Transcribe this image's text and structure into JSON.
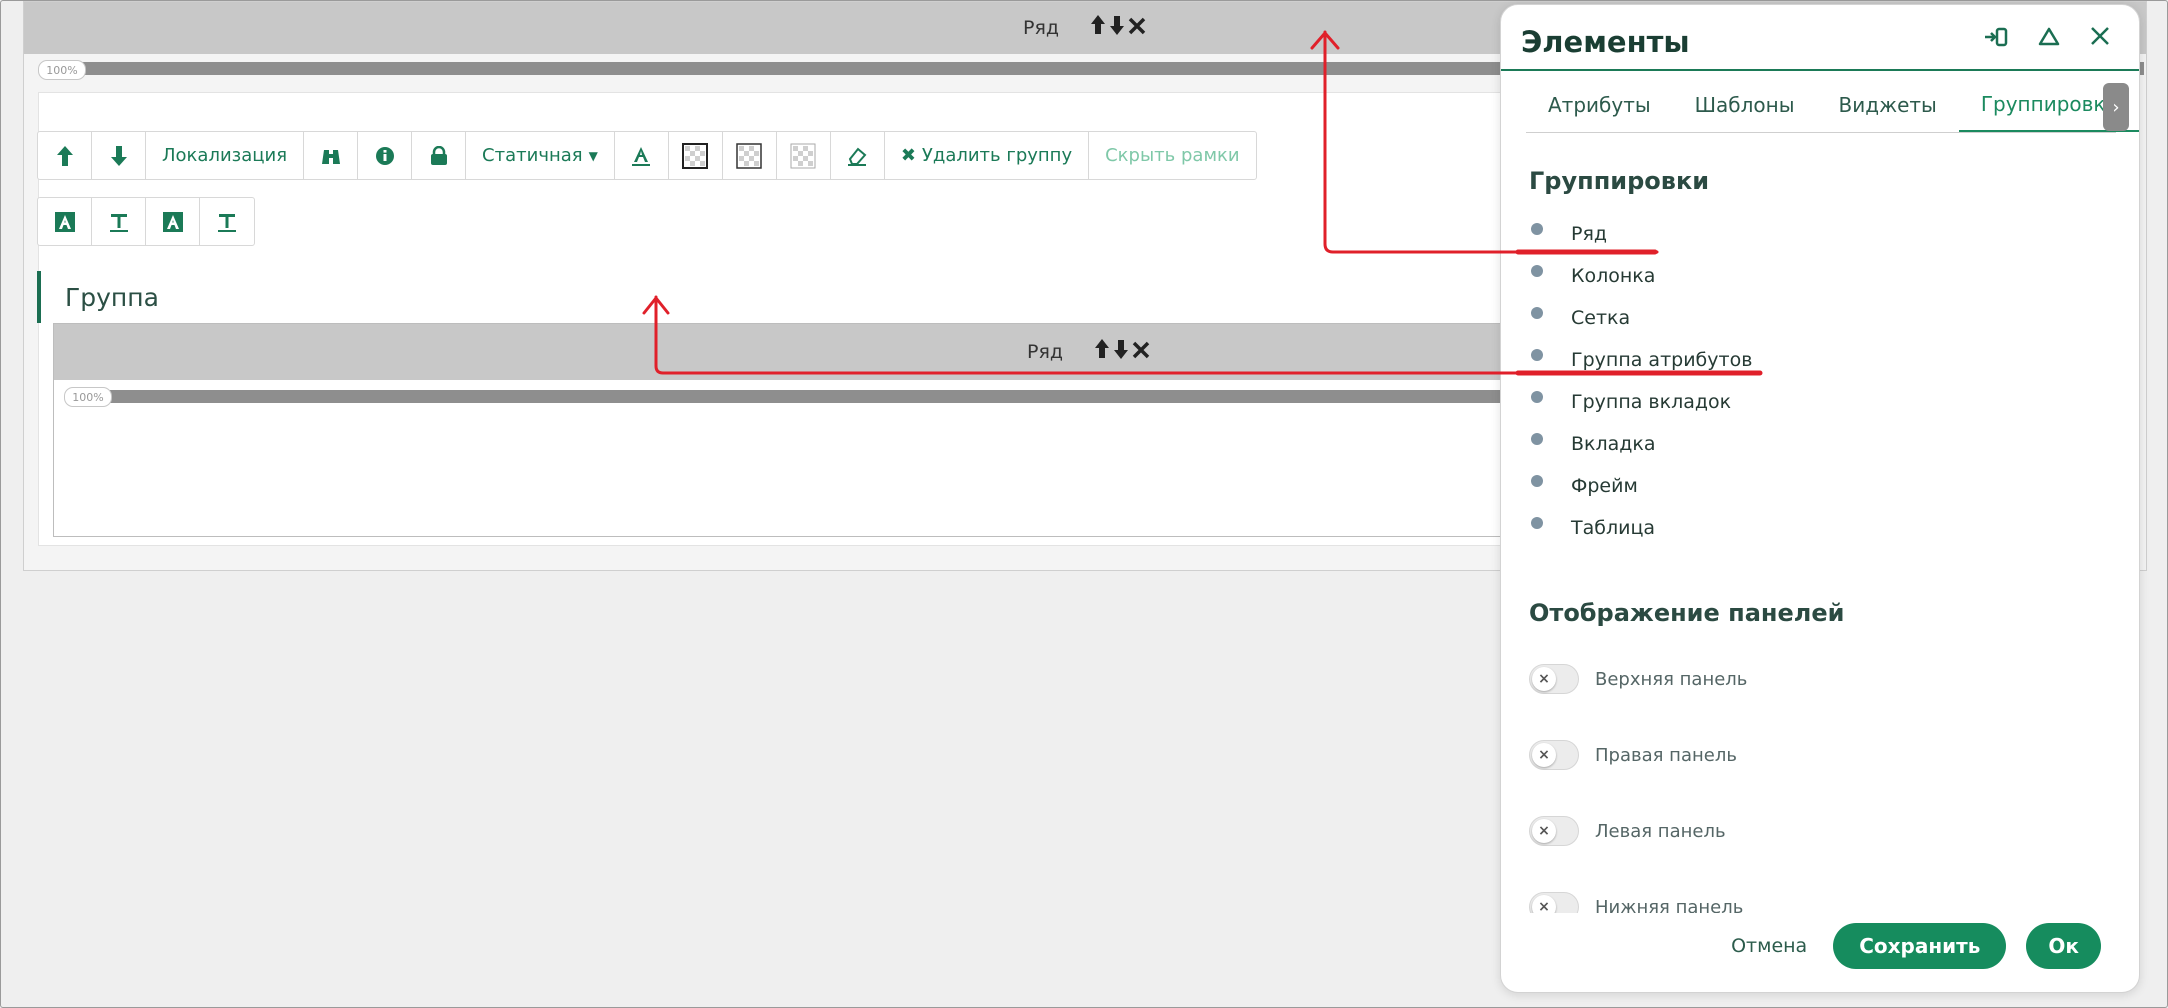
{
  "canvas": {
    "row_label": "Ряд",
    "row_controls": "🡑🡓✖",
    "percent": "100%",
    "group_title": "Группа"
  },
  "toolbar": {
    "localization": "Локализация",
    "static_label": "Статичная",
    "delete_group": "Удалить группу",
    "hide_frames": "Скрыть рамки"
  },
  "panel": {
    "title": "Элементы",
    "tabs": [
      "Атрибуты",
      "Шаблоны",
      "Виджеты",
      "Группировки"
    ],
    "groupings_title": "Группировки",
    "groupings": [
      "Ряд",
      "Колонка",
      "Сетка",
      "Группа атрибутов",
      "Группа вкладок",
      "Вкладка",
      "Фрейм",
      "Таблица"
    ],
    "panels_title": "Отображение панелей",
    "panels": [
      "Верхняя панель",
      "Правая панель",
      "Левая панель",
      "Нижняя панель"
    ],
    "cancel": "Отмена",
    "save": "Сохранить",
    "ok": "Ок"
  },
  "colors": {
    "accent": "#168c5e",
    "annotation": "#e0202a"
  }
}
